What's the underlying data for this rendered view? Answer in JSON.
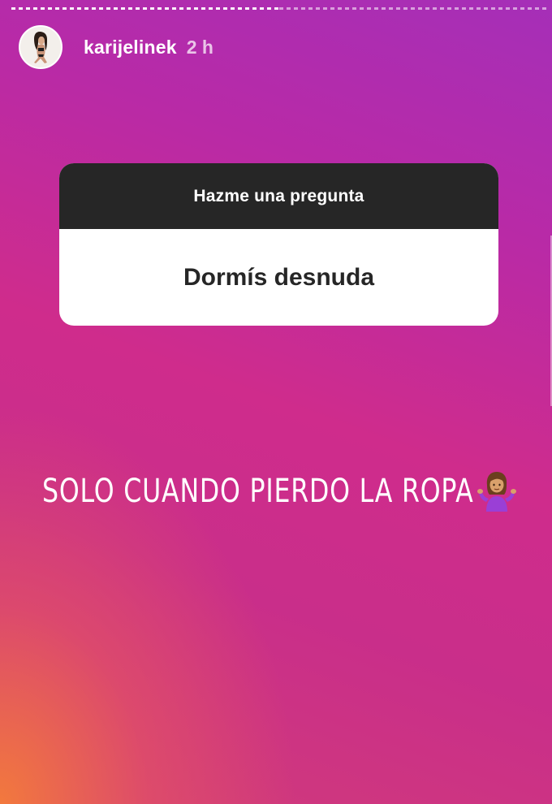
{
  "story": {
    "progress": {
      "segments": 2,
      "current_index": 0
    },
    "header": {
      "username": "karijelinek",
      "timestamp": "2 h",
      "avatar_icon": "profile-avatar"
    },
    "question_sticker": {
      "prompt": "Hazme una pregunta",
      "question": "Dormís desnuda"
    },
    "answer": {
      "text": "SOLO CUANDO PIERDO LA ROPA",
      "emoji_icon": "person-shrugging-icon"
    },
    "colors": {
      "gradient_top": "#a52fb8",
      "gradient_mid": "#cf2c8c",
      "gradient_bottom_left": "#f47c3a",
      "sticker_header": "#262626",
      "sticker_body": "#ffffff",
      "shrug_shirt": "#9a3fd6"
    }
  }
}
